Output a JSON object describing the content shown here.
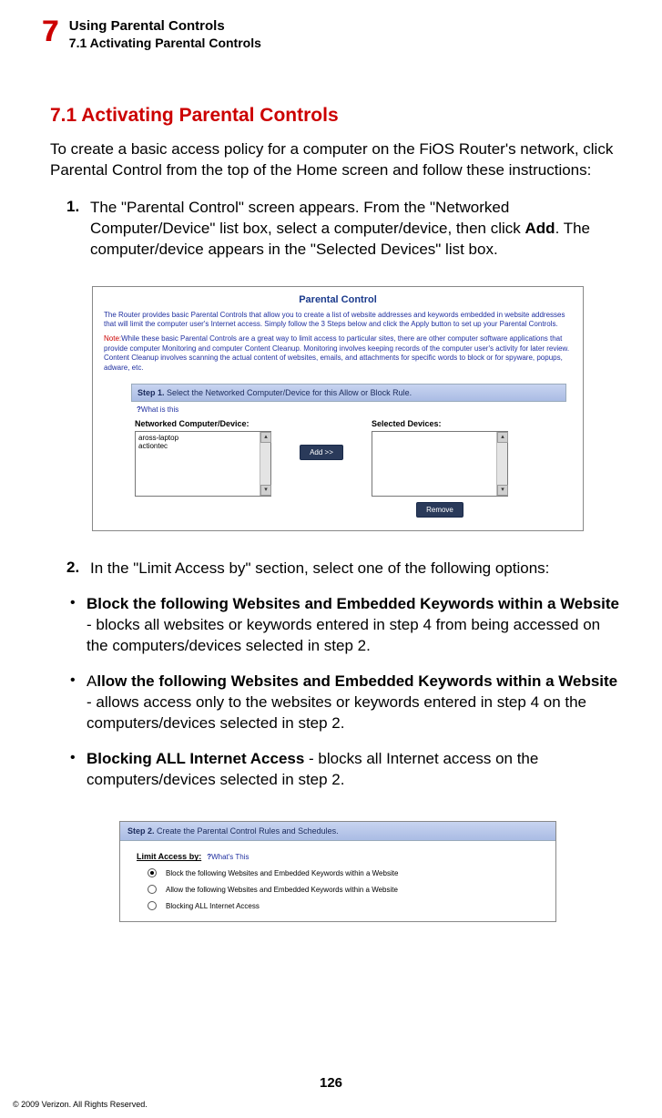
{
  "header": {
    "chapter_number": "7",
    "title": "Using Parental Controls",
    "subtitle": "7.1  Activating Parental Controls"
  },
  "section": {
    "heading": "7.1  Activating Parental Controls",
    "intro": "To create a basic access policy for a computer on the FiOS Router's network, click Parental Control from the top of the Home screen and follow these instructions:",
    "step1_num": "1.",
    "step1_a": "The \"Parental Control\" screen appears. From the \"Networked Computer/Device\" list box, select a computer/device, then click ",
    "step1_add": "Add",
    "step1_b": ". The computer/device appears in the \"Selected Devices\" list box.",
    "step2_num": "2.",
    "step2_text": " In the \"Limit Access by\" section, select one of the following options:"
  },
  "bullets": {
    "b1_title": "Block the following Websites and Embedded Keywords within a Website",
    "b1_text": " - blocks all websites or keywords entered in step 4 from being accessed on the computers/devices selected in step 2.",
    "b2_pre": "A",
    "b2_title": "llow the following Websites and Embedded Keywords within a Website",
    "b2_text": " - allows access only to the websites or keywords entered in step 4 on the computers/devices selected in step 2.",
    "b3_title": "Blocking ALL Internet Access",
    "b3_text": " - blocks all Internet access on the computers/devices selected in step 2."
  },
  "screenshot1": {
    "title": "Parental Control",
    "desc": "The Router provides basic Parental Controls that allow you to create a list of website addresses and keywords embedded in website addresses that will limit the computer user's Internet access. Simply follow the 3 Steps below and click the Apply button to set up your Parental Controls.",
    "note_label": "Note:",
    "note_text": "While these basic Parental Controls are a great way to limit access to particular sites, there are other computer software applications that provide computer Monitoring and computer Content Cleanup. Monitoring involves keeping records of the computer user's activity for later review. Content Cleanup involves scanning the actual content of websites, emails, and attachments for specific words to block or for spyware, popups, adware, etc.",
    "step1_label": "Step 1.",
    "step1_text": " Select the Networked Computer/Device for this Allow or Block Rule.",
    "what_link": "What is this",
    "left_label": "Networked Computer/Device:",
    "right_label": "Selected Devices:",
    "device1": "aross-laptop",
    "device2": "actiontec",
    "btn_add": "Add >>",
    "btn_remove": "Remove"
  },
  "screenshot2": {
    "step2_label": "Step 2.",
    "step2_text": " Create the Parental Control Rules and Schedules.",
    "limit_label": "Limit Access by:",
    "what": "What's This",
    "opt1": "Block the following Websites and Embedded Keywords within a Website",
    "opt2": "Allow the following Websites and Embedded Keywords within a Website",
    "opt3": "Blocking ALL Internet Access"
  },
  "footer": {
    "page": "126",
    "copyright": "© 2009 Verizon. All Rights Reserved."
  }
}
